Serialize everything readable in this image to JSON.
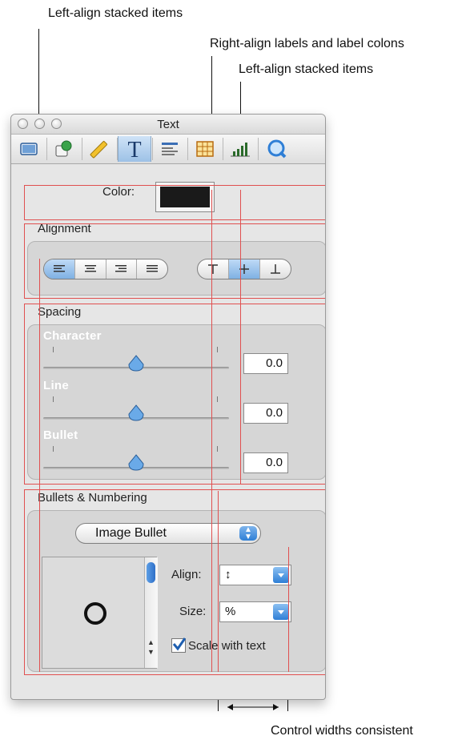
{
  "annotations": {
    "left_align_top": "Left-align stacked items",
    "right_align_labels": "Right-align labels and label colons",
    "left_align_right": "Left-align stacked items",
    "control_widths": "Control widths consistent"
  },
  "window": {
    "title": "Text",
    "toolbar_icons": [
      "document-icon",
      "graphic-icon",
      "metrics-icon",
      "text-icon",
      "wrap-icon",
      "table-icon",
      "chart-icon",
      "quicktime-icon"
    ],
    "active_toolbar_icon": "text-icon"
  },
  "color_row": {
    "label": "Color:",
    "swatch": "#1a1a1a"
  },
  "alignment": {
    "title": "Alignment",
    "horizontal": [
      "align-left-icon",
      "align-center-icon",
      "align-right-icon",
      "align-justify-icon"
    ],
    "horizontal_selected": "align-left-icon",
    "vertical": [
      "align-top-icon",
      "align-middle-icon",
      "align-bottom-icon"
    ],
    "vertical_selected": "align-middle-icon"
  },
  "spacing": {
    "title": "Spacing",
    "sliders": [
      {
        "label": "Character",
        "value": "0.0"
      },
      {
        "label": "Line",
        "value": "0.0"
      },
      {
        "label": "Bullet",
        "value": "0.0"
      }
    ]
  },
  "bullets": {
    "title": "Bullets & Numbering",
    "type_popup": "Image Bullet",
    "align_label": "Align:",
    "align_value": "↕",
    "size_label": "Size:",
    "size_value": "%",
    "scale_checkbox_label": "Scale with text",
    "scale_checked": true
  },
  "colors": {
    "guide_red": "#e05050",
    "accent_blue": "#2f7fd6"
  }
}
